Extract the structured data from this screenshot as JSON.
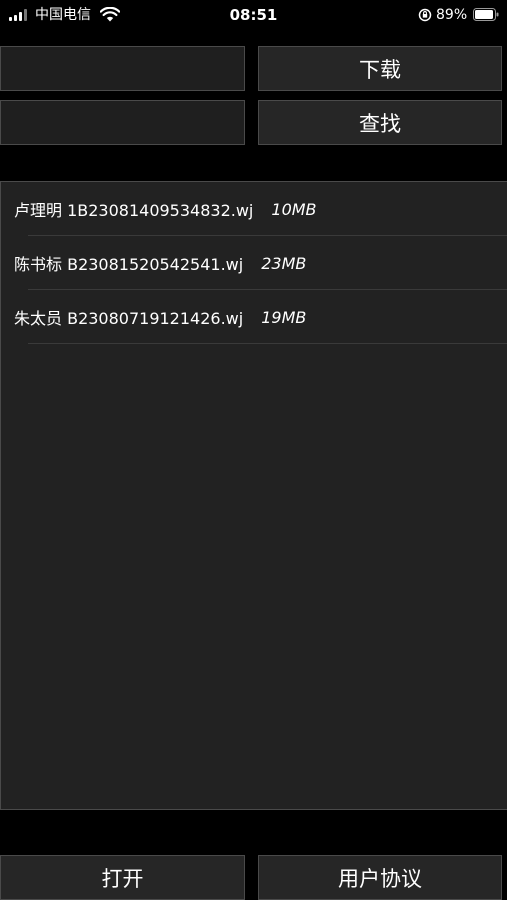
{
  "status_bar": {
    "carrier": "中国电信",
    "time": "08:51",
    "battery": "89%"
  },
  "toolbar": {
    "download_label": "下载",
    "search_label": "查找",
    "input_1_value": "",
    "input_2_value": ""
  },
  "files": [
    {
      "name": "卢理明 1B23081409534832.wj",
      "size": "10MB"
    },
    {
      "name": "陈书标 B23081520542541.wj",
      "size": "23MB"
    },
    {
      "name": "朱太员 B23080719121426.wj",
      "size": "19MB"
    }
  ],
  "bottom": {
    "open_label": "打开",
    "agreement_label": "用户协议"
  },
  "colors": {
    "background": "#000000",
    "panel": "#222222",
    "button": "#262626",
    "border": "#4a4a4a",
    "text": "#ffffff"
  }
}
